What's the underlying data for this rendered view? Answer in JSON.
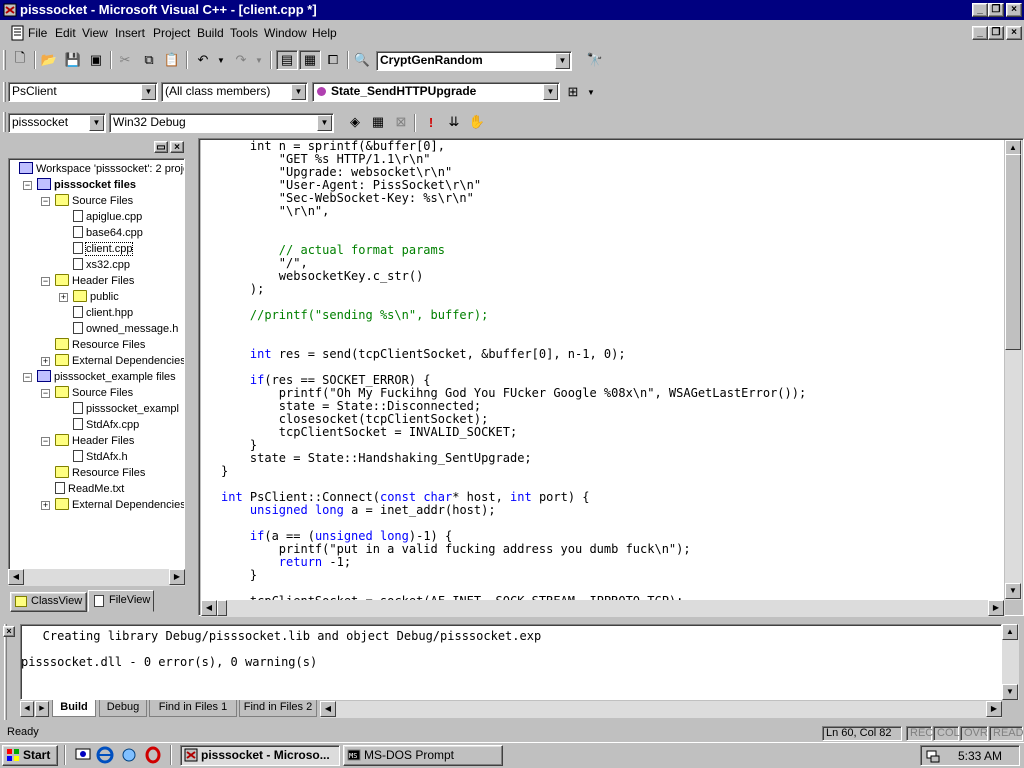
{
  "window": {
    "title": "pisssocket - Microsoft Visual C++ - [client.cpp *]"
  },
  "menu": [
    "File",
    "Edit",
    "View",
    "Insert",
    "Project",
    "Build",
    "Tools",
    "Window",
    "Help"
  ],
  "toolbar": {
    "find_combo": "CryptGenRandom",
    "class_combo": "PsClient",
    "filter_combo": "(All class members)",
    "member_combo": "State_SendHTTPUpgrade",
    "project_combo": "pisssocket",
    "config_combo": "Win32 Debug"
  },
  "workspace": {
    "tree": [
      {
        "label": "Workspace 'pisssocket': 2 proje",
        "indent": 0,
        "icon": "workspace-icon",
        "bold": false
      },
      {
        "label": "pisssocket files",
        "indent": 1,
        "icon": "project-icon",
        "bold": true,
        "pm": "-"
      },
      {
        "label": "Source Files",
        "indent": 2,
        "icon": "folder-icon",
        "pm": "-"
      },
      {
        "label": "apiglue.cpp",
        "indent": 3,
        "icon": "file-icon"
      },
      {
        "label": "base64.cpp",
        "indent": 3,
        "icon": "file-icon"
      },
      {
        "label": "client.cpp",
        "indent": 3,
        "icon": "file-icon",
        "selected": true
      },
      {
        "label": "xs32.cpp",
        "indent": 3,
        "icon": "file-icon"
      },
      {
        "label": "Header Files",
        "indent": 2,
        "icon": "folder-icon",
        "pm": "-"
      },
      {
        "label": "public",
        "indent": 3,
        "icon": "folder-icon",
        "pm": "+"
      },
      {
        "label": "client.hpp",
        "indent": 3,
        "icon": "file-icon"
      },
      {
        "label": "owned_message.h",
        "indent": 3,
        "icon": "file-icon"
      },
      {
        "label": "Resource Files",
        "indent": 2,
        "icon": "folder-icon"
      },
      {
        "label": "External Dependencies",
        "indent": 2,
        "icon": "folder-icon",
        "pm": "+"
      },
      {
        "label": "pisssocket_example files",
        "indent": 1,
        "icon": "project-icon",
        "pm": "-"
      },
      {
        "label": "Source Files",
        "indent": 2,
        "icon": "folder-icon",
        "pm": "-"
      },
      {
        "label": "pisssocket_exampl",
        "indent": 3,
        "icon": "file-icon"
      },
      {
        "label": "StdAfx.cpp",
        "indent": 3,
        "icon": "file-icon"
      },
      {
        "label": "Header Files",
        "indent": 2,
        "icon": "folder-icon",
        "pm": "-"
      },
      {
        "label": "StdAfx.h",
        "indent": 3,
        "icon": "file-icon"
      },
      {
        "label": "Resource Files",
        "indent": 2,
        "icon": "folder-icon"
      },
      {
        "label": "ReadMe.txt",
        "indent": 2,
        "icon": "file-icon"
      },
      {
        "label": "External Dependencies",
        "indent": 2,
        "icon": "folder-icon",
        "pm": "+"
      }
    ],
    "tabs": [
      "ClassView",
      "FileView"
    ]
  },
  "code_lines": [
    [
      [
        "    int n = sprintf(&buffer[0],",
        ""
      ]
    ],
    [
      [
        "        \"GET %s HTTP/1.1\\r\\n\"",
        ""
      ]
    ],
    [
      [
        "        \"Upgrade: websocket\\r\\n\"",
        ""
      ]
    ],
    [
      [
        "        \"User-Agent: PissSocket\\r\\n\"",
        ""
      ]
    ],
    [
      [
        "        \"Sec-WebSocket-Key: %s\\r\\n\"",
        ""
      ]
    ],
    [
      [
        "        \"\\r\\n\",",
        ""
      ]
    ],
    [
      [
        "",
        ""
      ]
    ],
    [
      [
        "",
        ""
      ]
    ],
    [
      [
        "        // actual format params",
        "cm"
      ]
    ],
    [
      [
        "        \"/\",",
        ""
      ]
    ],
    [
      [
        "        websocketKey.c_str()",
        ""
      ]
    ],
    [
      [
        "    );",
        ""
      ]
    ],
    [
      [
        "",
        ""
      ]
    ],
    [
      [
        "    //printf(\"sending %s\\n\", buffer);",
        "cm"
      ]
    ],
    [
      [
        "",
        ""
      ]
    ],
    [
      [
        "",
        ""
      ]
    ],
    [
      [
        "    ",
        ""
      ],
      [
        "int",
        "kw"
      ],
      [
        " res = send(tcpClientSocket, &buffer[0], n-1, 0);",
        ""
      ]
    ],
    [
      [
        "",
        ""
      ]
    ],
    [
      [
        "    ",
        ""
      ],
      [
        "if",
        "kw"
      ],
      [
        "(res == SOCKET_ERROR) {",
        ""
      ]
    ],
    [
      [
        "        printf(\"Oh My Fuckihng God You FUcker Google %08x\\n\", WSAGetLastError());",
        ""
      ]
    ],
    [
      [
        "        state = State::Disconnected;",
        ""
      ]
    ],
    [
      [
        "        closesocket(tcpClientSocket);",
        ""
      ]
    ],
    [
      [
        "        tcpClientSocket = INVALID_SOCKET;",
        ""
      ]
    ],
    [
      [
        "    }",
        ""
      ]
    ],
    [
      [
        "    state = State::Handshaking_SentUpgrade;",
        ""
      ]
    ],
    [
      [
        "}",
        ""
      ]
    ],
    [
      [
        "",
        ""
      ]
    ],
    [
      [
        "int",
        "kw"
      ],
      [
        " PsClient::Connect(",
        ""
      ],
      [
        "const",
        "kw"
      ],
      [
        " ",
        ""
      ],
      [
        "char",
        "kw"
      ],
      [
        "* host, ",
        ""
      ],
      [
        "int",
        "kw"
      ],
      [
        " port) {",
        ""
      ]
    ],
    [
      [
        "    ",
        ""
      ],
      [
        "unsigned",
        "kw"
      ],
      [
        " ",
        ""
      ],
      [
        "long",
        "kw"
      ],
      [
        " a = inet_addr(host);",
        ""
      ]
    ],
    [
      [
        "",
        ""
      ]
    ],
    [
      [
        "    ",
        ""
      ],
      [
        "if",
        "kw"
      ],
      [
        "(a == (",
        ""
      ],
      [
        "unsigned",
        "kw"
      ],
      [
        " ",
        ""
      ],
      [
        "long",
        "kw"
      ],
      [
        ")-1) {",
        ""
      ]
    ],
    [
      [
        "        printf(\"put in a valid fucking address you dumb fuck\\n\");",
        ""
      ]
    ],
    [
      [
        "        ",
        ""
      ],
      [
        "return",
        "kw"
      ],
      [
        " -1;",
        ""
      ]
    ],
    [
      [
        "    }",
        ""
      ]
    ],
    [
      [
        "",
        ""
      ]
    ],
    [
      [
        "    tcpClientSocket = socket(AF_INET, SOCK_STREAM, IPPROTO_TCP);",
        ""
      ]
    ]
  ],
  "output": {
    "lines": [
      "   Creating library Debug/pisssocket.lib and object Debug/pisssocket.exp",
      "pisssocket.dll - 0 error(s), 0 warning(s)"
    ],
    "tabs": [
      "Build",
      "Debug",
      "Find in Files 1",
      "Find in Files 2"
    ]
  },
  "status": {
    "ready": "Ready",
    "position": "Ln 60, Col 82",
    "indicators": [
      "REC",
      "COL",
      "OVR",
      "READ"
    ]
  },
  "taskbar": {
    "start": "Start",
    "tasks": [
      "pisssocket - Microso...",
      "MS-DOS Prompt"
    ],
    "clock": "5:33 AM"
  }
}
